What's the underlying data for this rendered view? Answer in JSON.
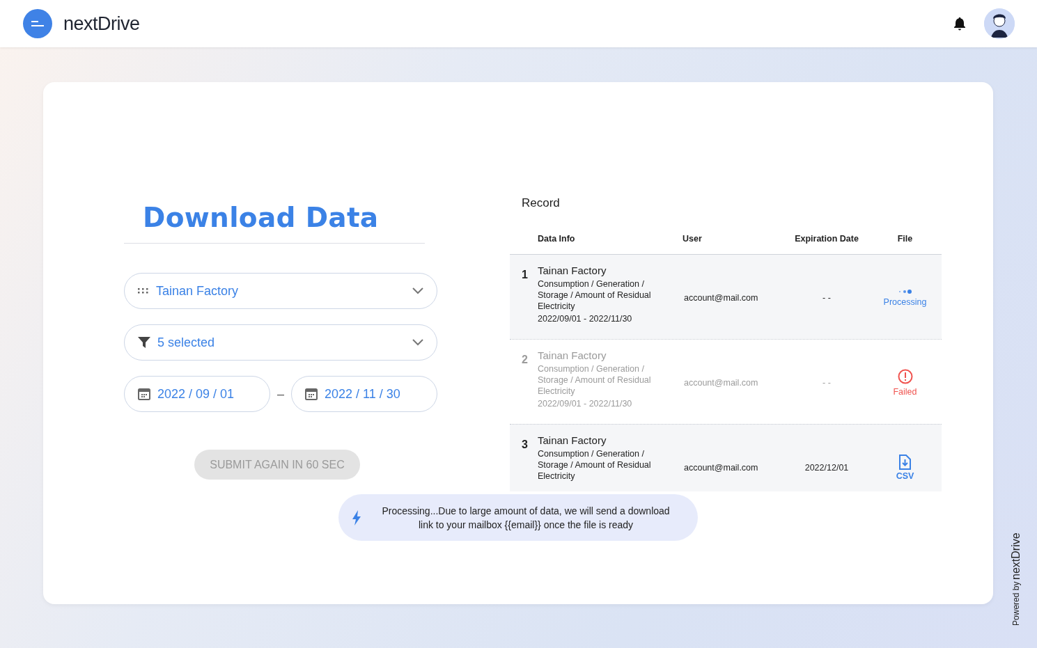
{
  "header": {
    "brand": "nextDrive"
  },
  "download": {
    "title": "Download Data",
    "selects": [
      {
        "kind": "location",
        "value": "Tainan Factory"
      },
      {
        "kind": "filter",
        "value": "5 selected"
      }
    ],
    "date_from": "2022 / 09 / 01",
    "date_separator": "–",
    "date_to": "2022 / 11 / 30",
    "submit": {
      "label": "SUBMIT AGAIN IN 60 SEC",
      "disabled": true
    }
  },
  "record": {
    "title": "Record",
    "columns": [
      "Data Info",
      "User",
      "Expiration Date",
      "File"
    ],
    "rows": [
      {
        "number": "1",
        "site": "Tainan Factory",
        "types": "Consumption / Generation / Storage / Amount of Residual Electricity",
        "period": "2022/09/01 - 2022/11/30",
        "user": "account@mail.com",
        "expiration": "- -",
        "file": {
          "kind": "processing",
          "label": "Processing"
        },
        "dimmed": false
      },
      {
        "number": "2",
        "site": "Tainan Factory",
        "types": "Consumption / Generation / Storage / Amount of Residual Electricity",
        "period": "2022/09/01 - 2022/11/30",
        "user": "account@mail.com",
        "expiration": "- -",
        "file": {
          "kind": "failed",
          "label": "Failed"
        },
        "dimmed": true
      },
      {
        "number": "3",
        "site": "Tainan Factory",
        "types": "Consumption / Generation / Storage / Amount of Residual Electricity",
        "user": "account@mail.com",
        "expiration": "2022/12/01",
        "file": {
          "kind": "csv",
          "label": "CSV"
        },
        "dimmed": false
      }
    ]
  },
  "toast": {
    "message": "Processing...Due to large amount of data, we will send a download link to your mailbox {{email}} once the file is ready"
  },
  "footer": {
    "powered_by": "Powered by",
    "brand": "nextDrive"
  }
}
